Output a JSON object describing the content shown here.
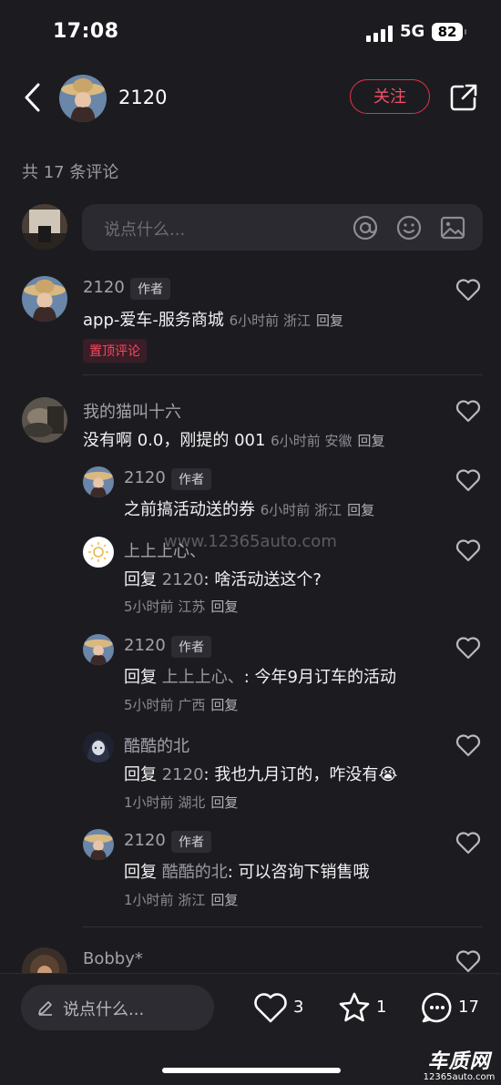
{
  "status": {
    "time": "17:08",
    "network": "5G",
    "battery": "82"
  },
  "header": {
    "username": "2120",
    "follow_label": "关注"
  },
  "comment_count": "共 17 条评论",
  "composer": {
    "placeholder": "说点什么..."
  },
  "comments": [
    {
      "user": "2120",
      "tag": "作者",
      "text": "app-爱车-服务商城",
      "time": "6小时前",
      "region": "浙江",
      "reply": "回复",
      "pinned": "置顶评论"
    },
    {
      "user": "我的猫叫十六",
      "text": "没有啊 0.0，刚提的 001",
      "time": "6小时前",
      "region": "安徽",
      "reply": "回复"
    }
  ],
  "replies": [
    {
      "user": "2120",
      "tag": "作者",
      "text": "之前搞活动送的券",
      "time": "6小时前",
      "region": "浙江",
      "reply": "回复"
    },
    {
      "user": "上上上心、",
      "prefix": "回复",
      "target": "2120",
      "text": ": 啥活动送这个?",
      "time": "5小时前",
      "region": "江苏",
      "reply": "回复"
    },
    {
      "user": "2120",
      "tag": "作者",
      "prefix": "回复",
      "target": "上上上心、",
      "text": ": 今年9月订车的活动",
      "time": "5小时前",
      "region": "广西",
      "reply": "回复"
    },
    {
      "user": "酷酷的北",
      "prefix": "回复",
      "target": "2120",
      "text": ": 我也九月订的，咋没有",
      "emoji": "😭",
      "time": "1小时前",
      "region": "湖北",
      "reply": "回复"
    },
    {
      "user": "2120",
      "tag": "作者",
      "prefix": "回复",
      "target": "酷酷的北",
      "text": ": 可以咨询下销售哦",
      "time": "1小时前",
      "region": "浙江",
      "reply": "回复"
    }
  ],
  "next_user": "Bobby*",
  "watermark": "www.12365auto.com",
  "bottom": {
    "placeholder": "说点什么...",
    "likes": "3",
    "favorites": "1",
    "comments": "17"
  },
  "logo": {
    "main": "车质网",
    "sub": "12365auto.com"
  },
  "colors": {
    "accent": "#e4314b",
    "background": "#1c1c20"
  }
}
